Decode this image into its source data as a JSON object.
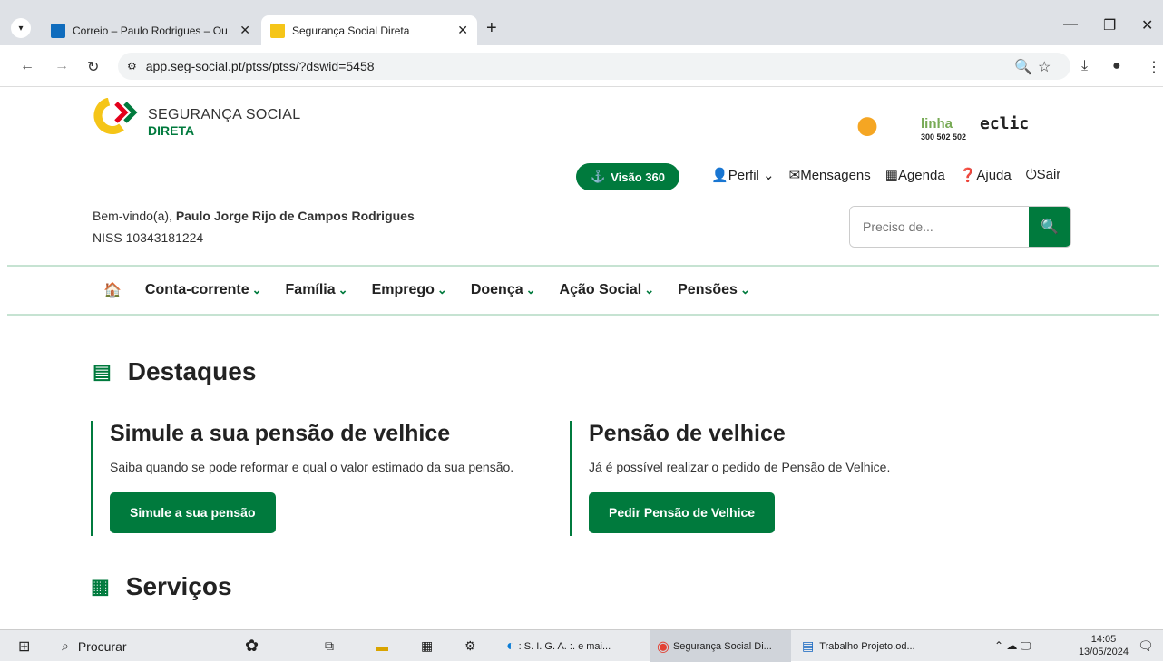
{
  "browser": {
    "tabs": [
      {
        "title": "Correio – Paulo Rodrigues – Ou",
        "active": false
      },
      {
        "title": "Segurança Social Direta",
        "active": true
      }
    ],
    "url": "app.seg-social.pt/ptss/ptss/?dswid=5458"
  },
  "header": {
    "brand_line1": "SEGURANÇA SOCIAL",
    "brand_line2": "DIRETA",
    "partner_linha": "linha",
    "partner_linha_number": "300 502 502",
    "partner_eclic": "eclic",
    "visao_label": "Visão 360",
    "menu": [
      "Perfil",
      "Mensagens",
      "Agenda",
      "Ajuda",
      "Sair"
    ]
  },
  "user": {
    "welcome_prefix": "Bem-vindo(a),",
    "name": "Paulo Jorge Rijo de Campos Rodrigues",
    "niss": "NISS 10343181224"
  },
  "search": {
    "placeholder": "Preciso de..."
  },
  "mainnav": [
    "Conta-corrente",
    "Família",
    "Emprego",
    "Doença",
    "Ação Social",
    "Pensões"
  ],
  "destaques": {
    "title": "Destaques",
    "cards": [
      {
        "title": "Simule a sua pensão de velhice",
        "text": "Saiba quando se pode reformar e qual o valor estimado da sua pensão.",
        "button": "Simule a sua pensão"
      },
      {
        "title": "Pensão de velhice",
        "text": "Já é possível realizar o pedido de Pensão de Velhice.",
        "button": "Pedir Pensão de Velhice"
      }
    ]
  },
  "servicos": {
    "title": "Serviços"
  },
  "taskbar": {
    "search": "Procurar",
    "apps": [
      ": S. I. G. A. :. e mai...",
      "Segurança Social Di...",
      "Trabalho Projeto.od..."
    ],
    "time": "14:05",
    "date": "13/05/2024"
  },
  "colors": {
    "brand_green": "#007a3d"
  }
}
